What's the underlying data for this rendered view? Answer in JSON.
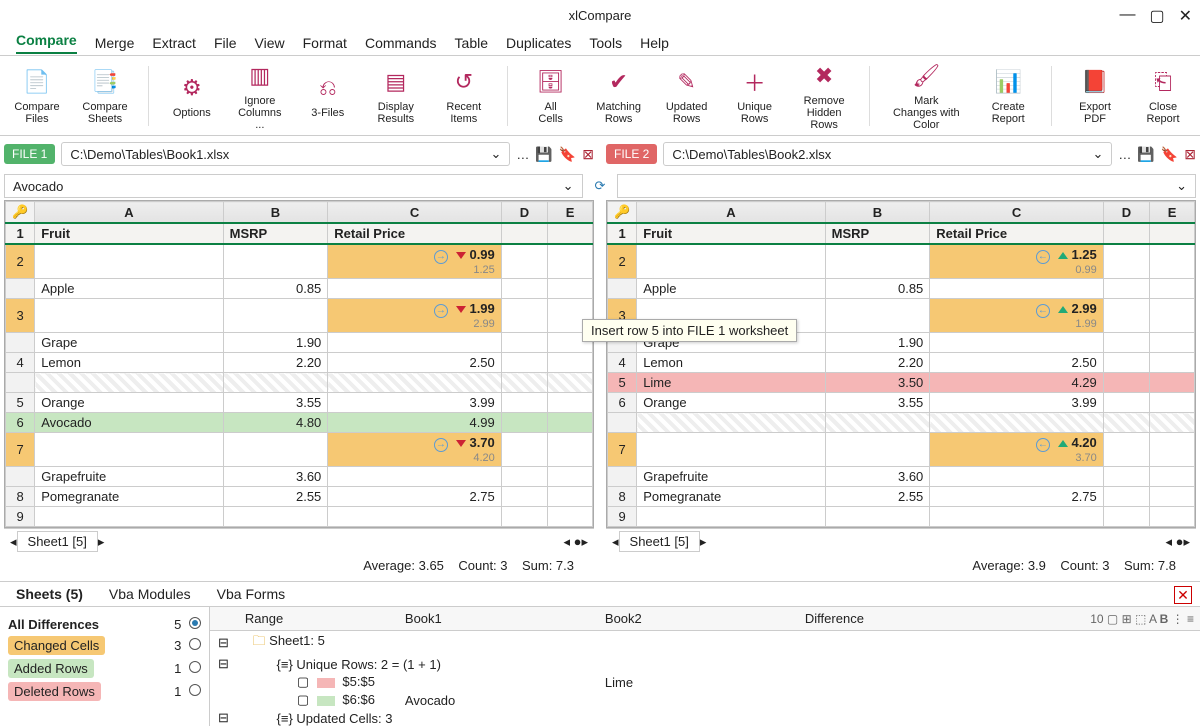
{
  "app": {
    "title": "xlCompare"
  },
  "menubar": [
    "Compare",
    "Merge",
    "Extract",
    "File",
    "View",
    "Format",
    "Commands",
    "Table",
    "Duplicates",
    "Tools",
    "Help"
  ],
  "ribbon": [
    {
      "label": "Compare Files",
      "icon": "📄"
    },
    {
      "label": "Compare Sheets",
      "icon": "📑"
    },
    {
      "label": "Options",
      "icon": "⚙"
    },
    {
      "label": "Ignore Columns ...",
      "icon": "▥"
    },
    {
      "label": "3-Files",
      "icon": "⎌"
    },
    {
      "label": "Display Results",
      "icon": "▤"
    },
    {
      "label": "Recent Items",
      "icon": "↺"
    },
    {
      "label": "All Cells",
      "icon": "🗄"
    },
    {
      "label": "Matching Rows",
      "icon": "✔"
    },
    {
      "label": "Updated Rows",
      "icon": "✎"
    },
    {
      "label": "Unique Rows",
      "icon": "＋"
    },
    {
      "label": "Remove Hidden Rows",
      "icon": "✖"
    },
    {
      "label": "Mark Changes with Color",
      "icon": "🖌"
    },
    {
      "label": "Create Report",
      "icon": "📊"
    },
    {
      "label": "Export PDF",
      "icon": "📕"
    },
    {
      "label": "Close Report",
      "icon": "⎗"
    }
  ],
  "files": {
    "left": {
      "tag": "FILE 1",
      "path": "C:\\Demo\\Tables\\Book1.xlsx"
    },
    "right": {
      "tag": "FILE 2",
      "path": "C:\\Demo\\Tables\\Book2.xlsx"
    }
  },
  "formula": {
    "left": "Avocado",
    "right": ""
  },
  "chart_data": {
    "type": "table",
    "left": {
      "columns": [
        "A",
        "B",
        "C",
        "D",
        "E"
      ],
      "headers": {
        "A": "Fruit",
        "B": "MSRP",
        "C": "Retail Price"
      },
      "rows": [
        {
          "n": 2,
          "mark": "chg",
          "C_main": "0.99",
          "C_sub": "1.25"
        },
        {
          "n": "",
          "A": "Apple",
          "B": "0.85"
        },
        {
          "n": 3,
          "mark": "chg",
          "C_main": "1.99",
          "C_sub": "2.99"
        },
        {
          "n": "",
          "A": "Grape",
          "B": "1.90"
        },
        {
          "n": 4,
          "A": "Lemon",
          "B": "2.20",
          "C": "2.50"
        },
        {
          "n": "",
          "hatched": true
        },
        {
          "n": 5,
          "A": "Orange",
          "B": "3.55",
          "C": "3.99"
        },
        {
          "n": 6,
          "add": true,
          "A": "Avocado",
          "B": "4.80",
          "C": "4.99"
        },
        {
          "n": 7,
          "mark": "chg",
          "C_main": "3.70",
          "C_sub": "4.20"
        },
        {
          "n": "",
          "A": "Grapefruite",
          "B": "3.60"
        },
        {
          "n": 8,
          "A": "Pomegranate",
          "B": "2.55",
          "C": "2.75"
        },
        {
          "n": 9
        }
      ]
    },
    "right": {
      "columns": [
        "A",
        "B",
        "C",
        "D",
        "E"
      ],
      "headers": {
        "A": "Fruit",
        "B": "MSRP",
        "C": "Retail Price"
      },
      "rows": [
        {
          "n": 2,
          "mark": "chg",
          "C_main": "1.25",
          "C_sub": "0.99"
        },
        {
          "n": "",
          "A": "Apple",
          "B": "0.85"
        },
        {
          "n": 3,
          "mark": "chg",
          "C_main": "2.99",
          "C_sub": "1.99"
        },
        {
          "n": "",
          "A": "Grape",
          "B": "1.90"
        },
        {
          "n": 4,
          "A": "Lemon",
          "B": "2.20",
          "C": "2.50"
        },
        {
          "n": 5,
          "del": true,
          "A": "Lime",
          "B": "3.50",
          "C": "4.29"
        },
        {
          "n": 6,
          "A": "Orange",
          "B": "3.55",
          "C": "3.99"
        },
        {
          "n": "",
          "hatched": true
        },
        {
          "n": 7,
          "mark": "chg",
          "C_main": "4.20",
          "C_sub": "3.70"
        },
        {
          "n": "",
          "A": "Grapefruite",
          "B": "3.60"
        },
        {
          "n": 8,
          "A": "Pomegranate",
          "B": "2.55",
          "C": "2.75"
        },
        {
          "n": 9
        }
      ]
    }
  },
  "sheet_tab": "Sheet1 [5]",
  "status": {
    "left": {
      "avg": "Average: 3.65",
      "count": "Count: 3",
      "sum": "Sum: 7.3"
    },
    "right": {
      "avg": "Average: 3.9",
      "count": "Count: 3",
      "sum": "Sum: 7.8"
    }
  },
  "bottom_tabs": [
    "Sheets (5)",
    "Vba Modules",
    "Vba Forms"
  ],
  "filters": [
    {
      "label": "All Differences",
      "count": "5",
      "on": true
    },
    {
      "label": "Changed Cells",
      "count": "3",
      "bg": "#f6c873"
    },
    {
      "label": "Added Rows",
      "count": "1",
      "bg": "#c7e6c1"
    },
    {
      "label": "Deleted Rows",
      "count": "1",
      "bg": "#f5b6b6"
    }
  ],
  "diff_headers": [
    "Range",
    "Book1",
    "Book2",
    "Difference"
  ],
  "diff_rows": [
    {
      "indent": 0,
      "icon": "⊟",
      "text": "Sheet1: 5"
    },
    {
      "indent": 1,
      "icon": "⊟",
      "text": "Unique Rows: 2 = (1 + 1)"
    },
    {
      "indent": 2,
      "bar": "#f5b6b6",
      "range": "$5:$5",
      "book2": "Lime"
    },
    {
      "indent": 2,
      "bar": "#c7e6c1",
      "range": "$6:$6",
      "book1": "Avocado"
    },
    {
      "indent": 1,
      "icon": "⊟",
      "text": "Updated Cells: 3"
    }
  ],
  "tooltip": "Insert row 5 into FILE 1 worksheet"
}
